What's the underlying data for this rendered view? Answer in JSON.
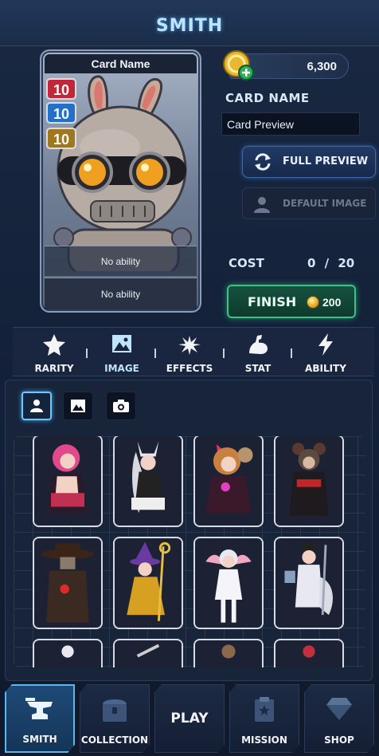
{
  "header": {
    "title": "SMITH"
  },
  "card": {
    "title": "Card Name",
    "stats": [
      "10",
      "10",
      "10"
    ],
    "ability_1": "No ability",
    "ability_2": "No ability"
  },
  "currency": {
    "coins": "6,300"
  },
  "form": {
    "card_name_label": "CARD NAME",
    "card_name_value": "Card Preview"
  },
  "buttons": {
    "full_preview": "FULL PREVIEW",
    "default_image": "DEFAULT IMAGE",
    "finish": "FINISH",
    "finish_price": "200"
  },
  "cost": {
    "label": "COST",
    "value": "0 / 20"
  },
  "tabs": [
    {
      "label": "RARITY",
      "icon": "star-icon"
    },
    {
      "label": "IMAGE",
      "icon": "image-icon"
    },
    {
      "label": "EFFECTS",
      "icon": "burst-icon"
    },
    {
      "label": "STAT",
      "icon": "muscle-icon"
    },
    {
      "label": "ABILITY",
      "icon": "lightning-icon"
    }
  ],
  "active_tab": "IMAGE",
  "image_subtabs": [
    "person-icon",
    "image-icon",
    "camera-icon"
  ],
  "nav": [
    {
      "label": "SMITH",
      "icon": "anvil-icon"
    },
    {
      "label": "COLLECTION",
      "icon": "chest-icon"
    },
    {
      "label": "PLAY",
      "icon": ""
    },
    {
      "label": "MISSION",
      "icon": "clipboard-icon"
    },
    {
      "label": "SHOP",
      "icon": "diamond-icon"
    }
  ],
  "colors": {
    "accent": "#5ab8f0",
    "finish": "#3ec08a",
    "coin": "#e0a820"
  }
}
